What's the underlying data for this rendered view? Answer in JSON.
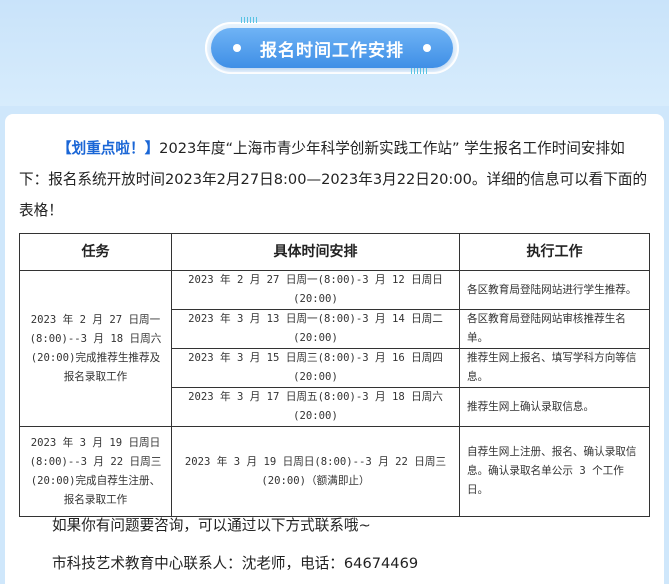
{
  "banner": {
    "title": "报名时间工作安排"
  },
  "intro": {
    "highlight": "【划重点啦！】",
    "text": "2023年度“上海市青少年科学创新实践工作站” 学生报名工作时间安排如下：报名系统开放时间2023年2月27日8:00—2023年3月22日20:00。详细的信息可以看下面的表格！"
  },
  "table": {
    "headers": [
      "任务",
      "具体时间安排",
      "执行工作"
    ],
    "group1": {
      "task": "2023 年 2 月 27 日周一(8:00)--3 月 18 日周六(20:00)完成推荐生推荐及报名录取工作",
      "rows": [
        {
          "time": "2023 年 2 月 27 日周一(8:00)-3 月 12 日周日(20:00)",
          "work": "各区教育局登陆网站进行学生推荐。"
        },
        {
          "time": "2023 年 3 月 13 日周一(8:00)-3 月 14 日周二(20:00)",
          "work": "各区教育局登陆网站审核推荐生名单。"
        },
        {
          "time": "2023 年 3 月 15 日周三(8:00)-3 月 16 日周四(20:00)",
          "work": "推荐生网上报名、填写学科方向等信息。"
        },
        {
          "time": "2023 年 3 月 17 日周五(8:00)-3 月 18 日周六(20:00)",
          "work": "推荐生网上确认录取信息。"
        }
      ]
    },
    "group2": {
      "task": "2023 年 3 月 19 日周日(8:00)--3 月 22 日周三(20:00)完成自荐生注册、报名录取工作",
      "time": "2023 年 3 月 19 日周日(8:00)--3 月 22 日周三(20:00)（额满即止）",
      "work": "自荐生网上注册、报名、确认录取信息。确认录取名单公示 3 个工作日。"
    }
  },
  "footer": {
    "line1": "如果你有问题要咨询，可以通过以下方式联系哦~",
    "line2": "市科技艺术教育中心联系人：沈老师，电话：64674469"
  }
}
